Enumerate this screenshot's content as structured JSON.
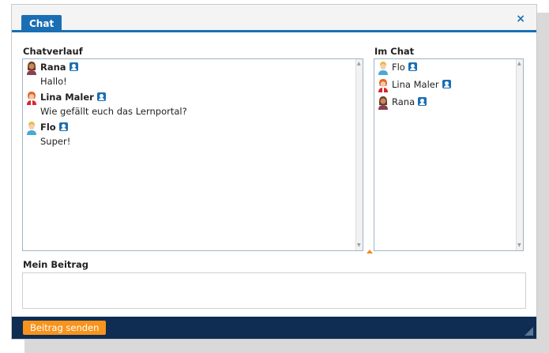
{
  "window": {
    "tab_label": "Chat",
    "close_symbol": "×"
  },
  "history": {
    "label": "Chatverlauf",
    "messages": [
      {
        "author": "Rana",
        "text": "Hallo!",
        "avatar": "woman-avatar-icon"
      },
      {
        "author": "Lina Maler",
        "text": "Wie gefällt euch das Lernportal?",
        "avatar": "redhead-avatar-icon"
      },
      {
        "author": "Flo",
        "text": "Super!",
        "avatar": "boy-avatar-icon"
      }
    ]
  },
  "participants": {
    "label": "Im Chat",
    "users": [
      {
        "name": "Flo"
      },
      {
        "name": "Lina Maler"
      },
      {
        "name": "Rana"
      }
    ]
  },
  "post": {
    "label": "Mein Beitrag",
    "value": "",
    "send_label": "Beitrag senden"
  },
  "colors": {
    "accent": "#1a6fb4",
    "footer": "#0f2c52",
    "button": "#f7941d"
  }
}
